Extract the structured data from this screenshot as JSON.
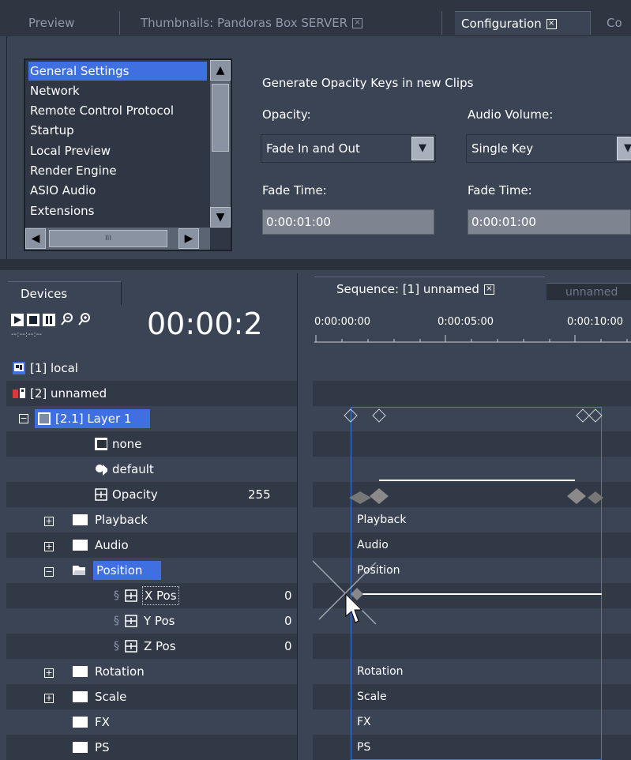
{
  "tabs": [
    {
      "label": "Preview",
      "closable": false,
      "active": false
    },
    {
      "label": "Thumbnails: Pandoras Box SERVER",
      "closable": true,
      "active": false
    },
    {
      "label": "Configuration",
      "closable": true,
      "active": true
    },
    {
      "label": "Co",
      "closable": false,
      "active": false
    }
  ],
  "config": {
    "categories": [
      "General Settings",
      "Network",
      "Remote Control Protocol",
      "Startup",
      "Local Preview",
      "Render Engine",
      "ASIO Audio",
      "Extensions"
    ],
    "selected_category": "General Settings",
    "heading": "Generate Opacity Keys in new Clips",
    "opacity_label": "Opacity:",
    "opacity_value": "Fade In and Out",
    "audio_label": "Audio Volume:",
    "audio_value": "Single Key",
    "fade_label_1": "Fade Time:",
    "fade_value_1": "0:00:01:00",
    "fade_label_2": "Fade Time:",
    "fade_value_2": "0:00:01:00",
    "hscroll_thumb": "III"
  },
  "devices": {
    "tab_label": "Devices",
    "timecode": "00:00:2",
    "timecode_small": "--:--:--:--",
    "tree": [
      {
        "label": "[1] local"
      },
      {
        "label": "[2] unnamed"
      },
      {
        "label": "[2.1] Layer 1"
      },
      {
        "label": "none"
      },
      {
        "label": "default"
      },
      {
        "label": "Opacity",
        "value": "255"
      },
      {
        "label": "Playback"
      },
      {
        "label": "Audio"
      },
      {
        "label": "Position"
      },
      {
        "label": "X Pos",
        "value": "0"
      },
      {
        "label": "Y Pos",
        "value": "0"
      },
      {
        "label": "Z Pos",
        "value": "0"
      },
      {
        "label": "Rotation"
      },
      {
        "label": "Scale"
      },
      {
        "label": "FX"
      },
      {
        "label": "PS"
      }
    ]
  },
  "sequence": {
    "tab_label": "Sequence: [1] unnamed",
    "tab2_label": "unnamed",
    "ruler": [
      "0:00:00:00",
      "0:00:05:00",
      "0:00:10:00"
    ],
    "track_labels": {
      "playback": "Playback",
      "audio": "Audio",
      "position": "Position",
      "rotation": "Rotation",
      "scale": "Scale",
      "fx": "FX",
      "ps": "PS"
    }
  },
  "colors": {
    "background": "#3b4454",
    "selection": "#3f6fe0",
    "clip_outline": "#3a7bd5"
  }
}
